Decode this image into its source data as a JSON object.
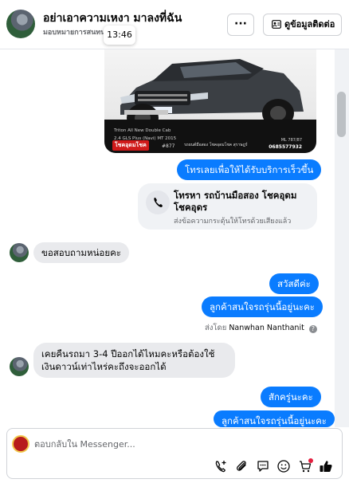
{
  "header": {
    "title": "อย่าเอาความเหงา มาลงที่ฉัน",
    "subtitle": "มอบหมายการสนทนา",
    "more_label": "···",
    "info_button_label": "ดูข้อมูลติดต่อ"
  },
  "tooltip": {
    "time": "13:46"
  },
  "car_card": {
    "model": "Triton All New Double Cab",
    "variant": "2.4 GLS Plus (Navi) MT 2015",
    "logo": "โชคอุดมโชค",
    "plate": "#877",
    "location": "รถยนต์มือสอง โชคอุดมโชค สุราษฎร์",
    "phone": "0685577932",
    "phone_top": "ML 787/87"
  },
  "messages": {
    "out_1": "โทรเลยเพื่อให้ได้รับบริการเร็วขึ้น",
    "call_title": "โทรหา รถบ้านมือสอง โชคอุดม โชคอุดร",
    "call_sub": "ส่งข้อความกระตุ้นให้โทรด้วยเสียงแล้ว",
    "in_1": "ขอสอบถามหน่อยคะ",
    "out_2": "สวัสดีค่ะ",
    "out_3": "ลูกค้าสนใจรถรุ่นนี้อยู่นะคะ",
    "sent_by_prefix": "ส่งโดย",
    "sent_by_name": "Nanwhan Nanthanit",
    "in_2": "เคยคืนรถมา 3-4 ปีออกได้ไหมคะหรือต้องใช้เงินดาวน์เท่าไหร่คะถึงจะออกได้",
    "out_4": "สักครู่นะคะ",
    "out_5": "ลูกค้าสนใจรถรุ่นนี้อยู่นะคะ"
  },
  "composer": {
    "placeholder": "ตอบกลับใน Messenger..."
  },
  "icons": {
    "more": "ellipsis-icon",
    "info": "contact-card-icon",
    "call": "phone-icon",
    "tools": [
      "phone-add-icon",
      "attachment-icon",
      "quick-reply-icon",
      "emoji-icon",
      "cart-icon",
      "like-icon"
    ]
  },
  "colors": {
    "accent": "#0a7cff",
    "incoming": "#e9eaed",
    "muted_text": "#65676b"
  }
}
